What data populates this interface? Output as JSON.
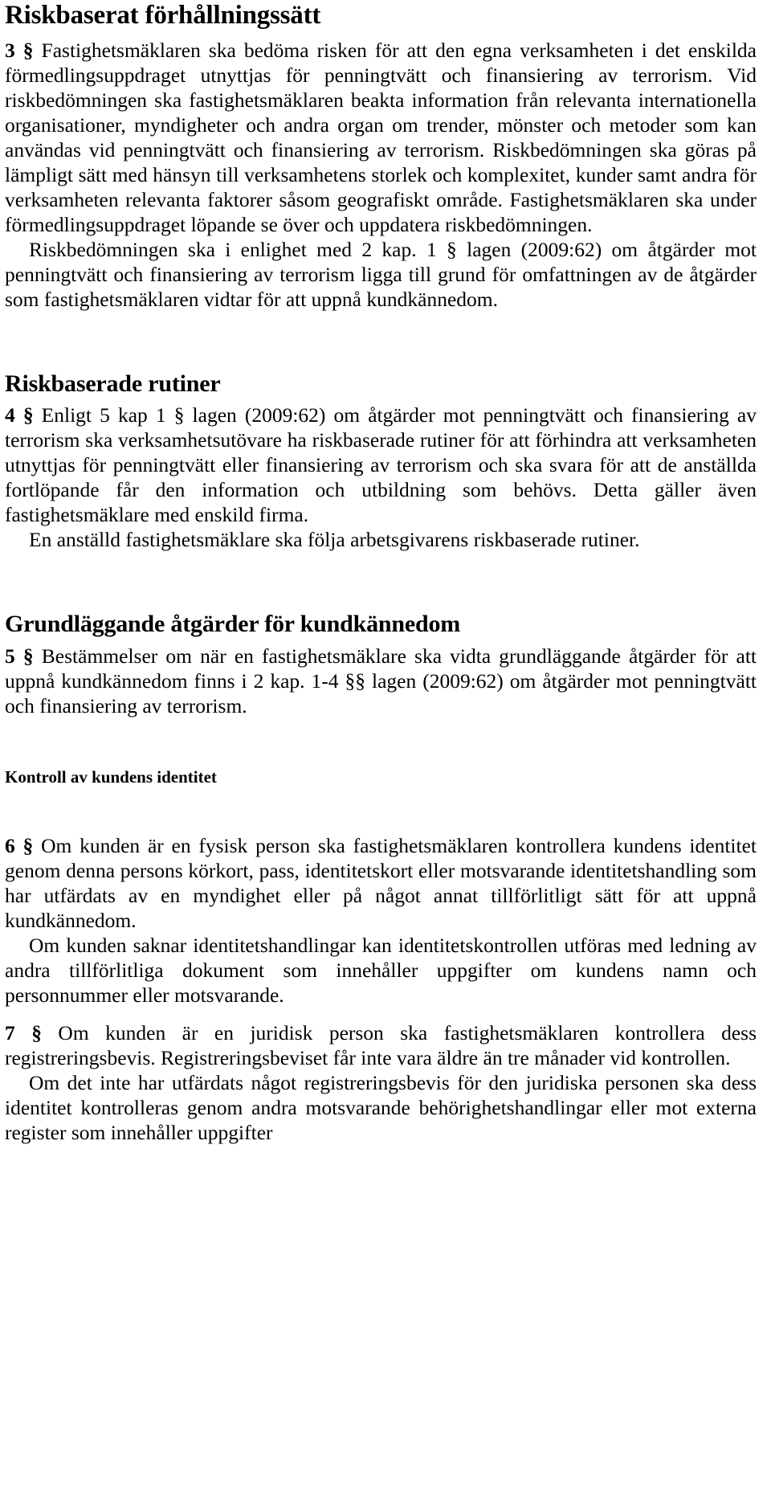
{
  "document": {
    "language": "sv",
    "title": "Riskbaserat förhållningssätt"
  },
  "sections": [
    {
      "id": "riskbaserat-forhallningssatt",
      "heading": "Riskbaserat förhållningssätt",
      "heading_level": 1,
      "paragraphs": [
        {
          "number": "3 §",
          "text": " Fastighetsmäklaren ska bedöma risken för att den egna verksamheten i det enskilda förmedlingsuppdraget utnyttjas för penningtvätt och finansiering av terrorism. Vid riskbedömningen ska fastighetsmäklaren beakta information från relevanta internationella organisationer, myndigheter och andra organ om trender, mönster och metoder som kan användas vid penningtvätt och finansiering av terrorism. Riskbedömningen ska göras på lämpligt sätt med hänsyn till verksamhetens storlek och komplexitet, kunder samt andra för verksamheten relevanta faktorer såsom geografiskt område. Fastighetsmäklaren ska under förmedlingsuppdraget löpande se över och uppdatera riskbedömningen."
        },
        {
          "number": "",
          "text": "Riskbedömningen ska i enlighet med 2 kap. 1 § lagen (2009:62) om åtgärder mot penningtvätt och finansiering av terrorism ligga till grund för omfattningen av de åtgärder som fastighetsmäklaren vidtar för att uppnå kundkännedom."
        }
      ]
    },
    {
      "id": "riskbaserade-rutiner",
      "heading": "Riskbaserade rutiner",
      "heading_level": 2,
      "paragraphs": [
        {
          "number": "4 §",
          "text": " Enligt 5 kap 1 § lagen (2009:62) om åtgärder mot penningtvätt och finansiering av terrorism ska verksamhetsutövare ha riskbaserade rutiner för att förhindra att verksamheten utnyttjas för penningtvätt eller finansiering av terrorism och ska svara för att de anställda fortlöpande får den information och utbildning som behövs. Detta gäller även fastighetsmäklare med enskild firma."
        },
        {
          "number": "",
          "text": "En anställd fastighetsmäklare ska följa arbetsgivarens riskbaserade rutiner."
        }
      ]
    },
    {
      "id": "grundlaggande-atgarder",
      "heading": "Grundläggande åtgärder för kundkännedom",
      "heading_level": 2,
      "paragraphs": [
        {
          "number": "5 §",
          "text": " Bestämmelser om när en fastighetsmäklare ska vidta grundläggande åtgärder för att uppnå kundkännedom finns i 2 kap. 1-4 §§ lagen (2009:62) om åtgärder mot penningtvätt och finansiering av terrorism."
        }
      ]
    },
    {
      "id": "kontroll-av-kundens-identitet",
      "heading": "Kontroll av kundens identitet",
      "heading_level": 3,
      "paragraphs": [
        {
          "number": "6 §",
          "text": " Om kunden är en fysisk person ska fastighetsmäklaren kontrollera kundens identitet genom denna persons körkort, pass, identitetskort eller motsvarande identitetshandling som har utfärdats av en myndighet eller på något annat tillförlitligt sätt för att uppnå kundkännedom."
        },
        {
          "number": "",
          "text": "Om kunden saknar identitetshandlingar kan identitetskontrollen utföras med ledning av andra tillförlitliga dokument som innehåller uppgifter om kundens namn och personnummer eller motsvarande."
        },
        {
          "number": "7 §",
          "text": " Om kunden är en juridisk person ska fastighetsmäklaren kontrollera dess registreringsbevis. Registreringsbeviset får inte vara äldre än tre månader vid kontrollen."
        },
        {
          "number": "",
          "text": "Om det inte har utfärdats något registreringsbevis för den juridiska personen ska dess identitet kontrolleras genom andra motsvarande behörighetshandlingar eller mot externa register som innehåller uppgifter"
        }
      ]
    }
  ]
}
